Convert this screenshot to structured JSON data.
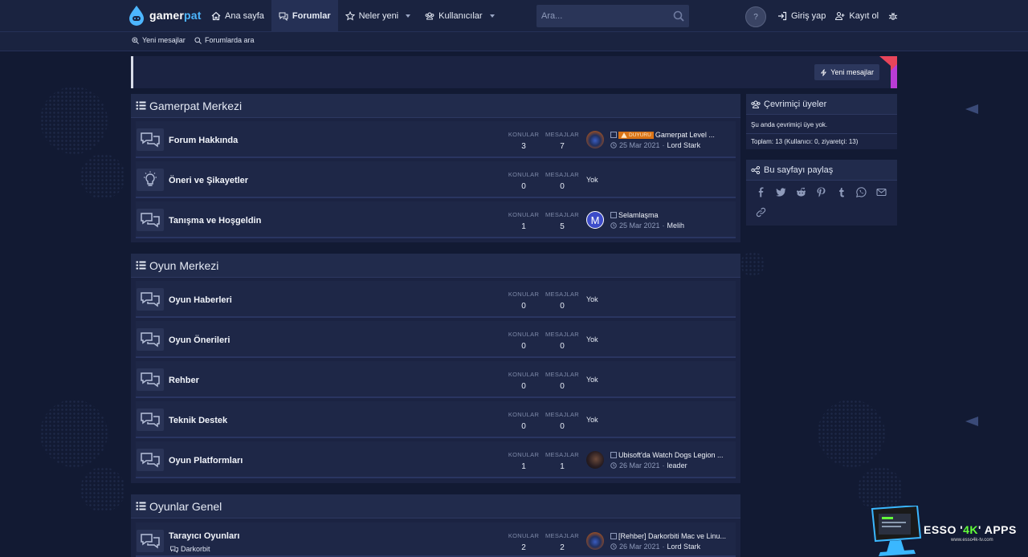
{
  "brand": {
    "name_part1": "gamer",
    "name_part2": "pat"
  },
  "nav": {
    "home": "Ana sayfa",
    "forums": "Forumlar",
    "whats_new": "Neler yeni",
    "members": "Kullanıcılar"
  },
  "search": {
    "placeholder": "Ara..."
  },
  "help_label": "?",
  "auth": {
    "login": "Giriş yap",
    "register": "Kayıt ol"
  },
  "subnav": {
    "new_posts": "Yeni mesajlar",
    "search_forums": "Forumlarda ara"
  },
  "notice": {
    "button": "Yeni mesajlar"
  },
  "stat_labels": {
    "threads": "KONULAR",
    "messages": "MESAJLAR"
  },
  "categories": [
    {
      "title": "Gamerpat Merkezi",
      "forums": [
        {
          "title": "Forum Hakkında",
          "threads": "3",
          "messages": "7",
          "last_badge": "DUYURU",
          "last_title": "Gamerpat Level ...",
          "last_date": "25 Mar 2021",
          "last_user": "Lord Stark"
        },
        {
          "title": "Öneri ve Şikayetler",
          "threads": "0",
          "messages": "0",
          "last_none": "Yok"
        },
        {
          "title": "Tanışma ve Hoşgeldin",
          "threads": "1",
          "messages": "5",
          "avatar_letter": "M",
          "last_title": "Selamlaşma",
          "last_date": "25 Mar 2021",
          "last_user": "Melih"
        }
      ]
    },
    {
      "title": "Oyun Merkezi",
      "forums": [
        {
          "title": "Oyun Haberleri",
          "threads": "0",
          "messages": "0",
          "last_none": "Yok"
        },
        {
          "title": "Oyun Önerileri",
          "threads": "0",
          "messages": "0",
          "last_none": "Yok"
        },
        {
          "title": "Rehber",
          "threads": "0",
          "messages": "0",
          "last_none": "Yok"
        },
        {
          "title": "Teknik Destek",
          "threads": "0",
          "messages": "0",
          "last_none": "Yok"
        },
        {
          "title": "Oyun Platformları",
          "threads": "1",
          "messages": "1",
          "last_title": "Ubisoft'da Watch Dogs Legion ...",
          "last_date": "26 Mar 2021",
          "last_user": "leader"
        }
      ]
    },
    {
      "title": "Oyunlar Genel",
      "forums": [
        {
          "title": "Tarayıcı Oyunları",
          "subforum": "Darkorbit",
          "threads": "2",
          "messages": "2",
          "last_title": "[Rehber] Darkorbiti Mac ve Linu...",
          "last_date": "26 Mar 2021",
          "last_user": "Lord Stark"
        }
      ]
    }
  ],
  "sidebar": {
    "online": {
      "title": "Çevrimiçi üyeler",
      "none_text": "Şu anda çevrimiçi üye yok.",
      "total_text": "Toplam: 13 (Kullanıcı: 0, ziyaretçi: 13)"
    },
    "share": {
      "title": "Bu sayfayı paylaş",
      "icons": [
        "facebook-icon",
        "twitter-icon",
        "reddit-icon",
        "pinterest-icon",
        "tumblr-icon",
        "whatsapp-icon",
        "email-icon",
        "link-icon"
      ]
    }
  },
  "watermark": {
    "text_a": "ESSO '",
    "text_b": "4K",
    "text_c": "' APPS",
    "url": "www.esso4k-tv.com"
  },
  "colors": {
    "background": "#121a33",
    "panel": "#1b2342",
    "accent_blue": "#4db6ff",
    "badge_orange": "#d97316"
  }
}
